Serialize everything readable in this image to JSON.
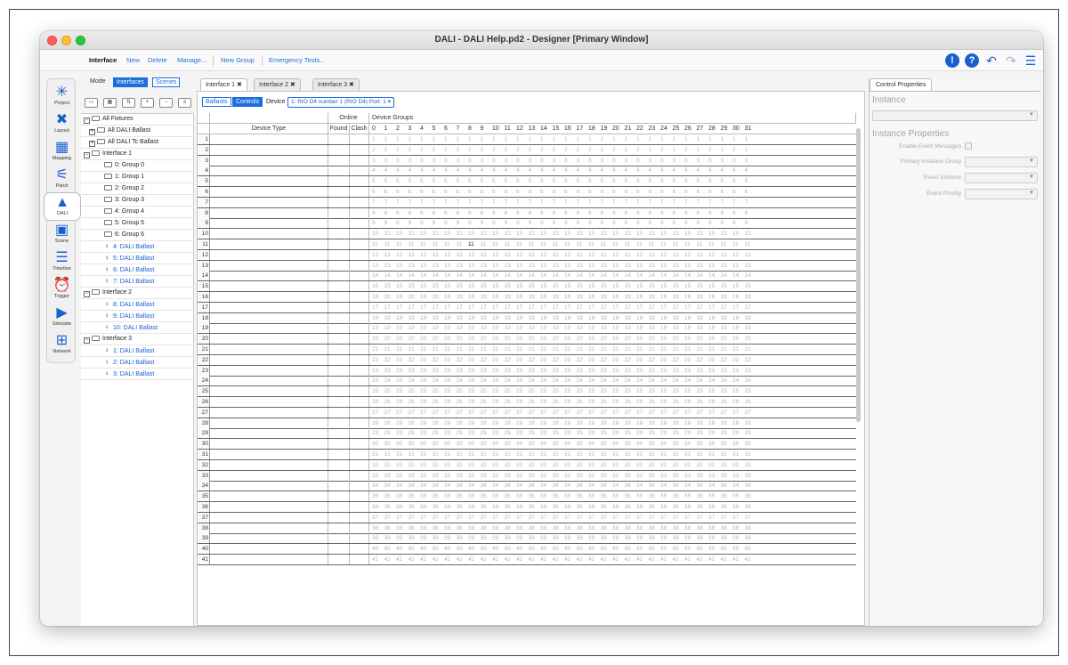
{
  "window": {
    "title": "DALI - DALI Help.pd2 - Designer [Primary Window]"
  },
  "toolbar": {
    "section": "Interface",
    "items": [
      "New",
      "Delete",
      "Manage...",
      "New Group",
      "Emergency Tests..."
    ]
  },
  "nav": [
    {
      "label": "Project",
      "icon": "project-icon"
    },
    {
      "label": "Layout",
      "icon": "layout-icon"
    },
    {
      "label": "Mapping",
      "icon": "mapping-icon"
    },
    {
      "label": "Patch",
      "icon": "patch-icon"
    },
    {
      "label": "DALI",
      "icon": "dali-icon"
    },
    {
      "label": "Scene",
      "icon": "scene-icon"
    },
    {
      "label": "Timeline",
      "icon": "timeline-icon"
    },
    {
      "label": "Trigger",
      "icon": "trigger-icon"
    },
    {
      "label": "Simulate",
      "icon": "simulate-icon"
    },
    {
      "label": "Network",
      "icon": "network-icon"
    }
  ],
  "mode": {
    "label": "Mode",
    "options": [
      "Interfaces",
      "Scenes"
    ],
    "selected": "Interfaces"
  },
  "tree": [
    {
      "label": "All Fixtures",
      "kind": "root"
    },
    {
      "label": "All DALI Ballast",
      "kind": "sub"
    },
    {
      "label": "All DALI Tc Ballast",
      "kind": "sub"
    },
    {
      "label": "Interface 1",
      "kind": "root"
    },
    {
      "label": "0: Group 0",
      "kind": "group"
    },
    {
      "label": "1: Group 1",
      "kind": "group"
    },
    {
      "label": "2: Group 2",
      "kind": "group"
    },
    {
      "label": "3: Group 3",
      "kind": "group"
    },
    {
      "label": "4: Group 4",
      "kind": "group"
    },
    {
      "label": "5: Group 5",
      "kind": "group"
    },
    {
      "label": "6: Group 6",
      "kind": "group"
    },
    {
      "label": "4: DALI Ballast",
      "kind": "ballast"
    },
    {
      "label": "5: DALI Ballast",
      "kind": "ballast"
    },
    {
      "label": "6: DALI Ballast",
      "kind": "ballast"
    },
    {
      "label": "7: DALI Ballast",
      "kind": "ballast"
    },
    {
      "label": "Interface 2",
      "kind": "root"
    },
    {
      "label": "8: DALI Ballast",
      "kind": "ballast"
    },
    {
      "label": "9: DALI Ballast",
      "kind": "ballast"
    },
    {
      "label": "10: DALI Ballast",
      "kind": "ballast"
    },
    {
      "label": "Interface 3",
      "kind": "root"
    },
    {
      "label": "1: DALI Ballast",
      "kind": "ballast"
    },
    {
      "label": "2: DALI Ballast",
      "kind": "ballast"
    },
    {
      "label": "3: DALI Ballast",
      "kind": "ballast"
    }
  ],
  "tabs": [
    "Interface 1",
    "Interface 2",
    "Interface 3"
  ],
  "content": {
    "view_options": [
      "Ballasts",
      "Controls"
    ],
    "view_selected": "Controls",
    "device_label": "Device",
    "device_value": "1: RIO D4 number 1 (RIO D4) Port: 1"
  },
  "grid": {
    "header_online": "Online",
    "header_device_groups": "Device Groups",
    "col_device_type": "Device Type",
    "col_found": "Found",
    "col_clash": "Clash",
    "group_numbers": [
      "0",
      "1",
      "2",
      "3",
      "4",
      "5",
      "6",
      "7",
      "8",
      "9",
      "10",
      "11",
      "12",
      "13",
      "14",
      "15",
      "16",
      "17",
      "18",
      "19",
      "20",
      "21",
      "22",
      "23",
      "24",
      "25",
      "26",
      "27",
      "28",
      "29",
      "30",
      "31"
    ],
    "row_count": 41,
    "highlight": {
      "row": 11,
      "group": 8
    }
  },
  "properties": {
    "tab": "Control Properties",
    "instance_heading": "Instance",
    "props_heading": "Instance Properties",
    "fields": [
      "Enable Event Messages",
      "Primary Instance Group",
      "Event Scheme",
      "Event Priority"
    ]
  }
}
